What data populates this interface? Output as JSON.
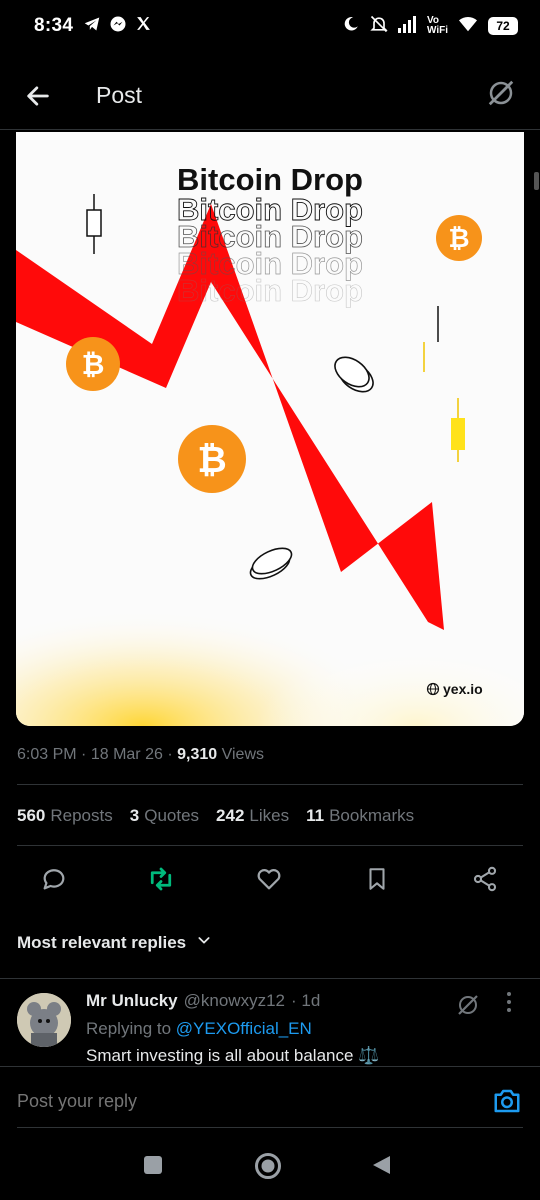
{
  "status_bar": {
    "time": "8:34",
    "vowifi_top": "Vo",
    "vowifi_bottom": "WiFi",
    "battery": "72"
  },
  "nav": {
    "title": "Post"
  },
  "post_image": {
    "headline": "Bitcoin Drop",
    "echo_lines": [
      "Bitcoin Drop",
      "Bitcoin Drop",
      "Bitcoin Drop",
      "Bitcoin Drop"
    ],
    "watermark": "yex.io",
    "accent_red": "#ff0a0a",
    "accent_orange": "#f7931a"
  },
  "meta": {
    "time": "6:03 PM",
    "date": "18 Mar 26",
    "views_count": "9,310",
    "views_label": "Views"
  },
  "stats": {
    "reposts_count": "560",
    "reposts_label": "Reposts",
    "quotes_count": "3",
    "quotes_label": "Quotes",
    "likes_count": "242",
    "likes_label": "Likes",
    "bookmarks_count": "11",
    "bookmarks_label": "Bookmarks"
  },
  "actions": {
    "reply_icon": "reply-icon",
    "repost_icon": "repost-icon",
    "like_icon": "heart-icon",
    "bookmark_icon": "bookmark-icon",
    "share_icon": "share-icon",
    "repost_active_color": "#00ba7c"
  },
  "replies_sort": {
    "label": "Most relevant replies"
  },
  "reply": {
    "name": "Mr Unlucky",
    "handle": "@knowxyz12",
    "time": "· 1d",
    "replying_prefix": "Replying to",
    "mention": "@YEXOfficial_EN",
    "text": "Smart investing is all about balance ⚖️"
  },
  "composer": {
    "placeholder": "Post your reply"
  }
}
